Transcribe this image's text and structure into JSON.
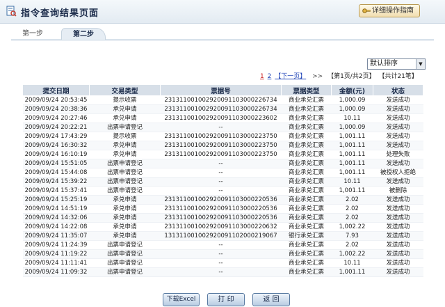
{
  "page": {
    "title": "指令查询结果页面",
    "help_label": "详细操作指南"
  },
  "tabs": [
    {
      "label": "第一步"
    },
    {
      "label": "第二步"
    }
  ],
  "sort": {
    "selected": "默认排序"
  },
  "pager": {
    "page1": "1",
    "page2": "2",
    "next": "【下一页】",
    "arrows": ">>",
    "page_info": "【第1页/共2页】",
    "total": "【共计21笔】"
  },
  "table": {
    "columns": [
      "提交日期",
      "交易类型",
      "票据号",
      "票据类型",
      "金额(元)",
      "状态"
    ],
    "rows": [
      [
        "2009/09/24 20:53:45",
        "提示收票",
        "231311001002920091103000226734",
        "商业承兑汇票",
        "1,000.09",
        "发送成功"
      ],
      [
        "2009/09/24 20:38:36",
        "承兑申请",
        "231311001002920091103000226734",
        "商业承兑汇票",
        "1,000.09",
        "发送成功"
      ],
      [
        "2009/09/24 20:27:46",
        "承兑申请",
        "231311001002920091103000223602",
        "商业承兑汇票",
        "10.11",
        "发送成功"
      ],
      [
        "2009/09/24 20:22:21",
        "出票申请登记",
        "--",
        "商业承兑汇票",
        "1,000.09",
        "发送成功"
      ],
      [
        "2009/09/24 17:43:29",
        "提示收票",
        "231311001002920091103000223750",
        "商业承兑汇票",
        "1,001.11",
        "发送成功"
      ],
      [
        "2009/09/24 16:30:32",
        "承兑申请",
        "231311001002920091103000223750",
        "商业承兑汇票",
        "1,001.11",
        "发送成功"
      ],
      [
        "2009/09/24 16:10:19",
        "承兑申请",
        "231311001002920091103000223750",
        "商业承兑汇票",
        "1,001.11",
        "处理失败"
      ],
      [
        "2009/09/24 15:51:05",
        "出票申请登记",
        "--",
        "商业承兑汇票",
        "1,001.11",
        "发送成功"
      ],
      [
        "2009/09/24 15:44:08",
        "出票申请登记",
        "--",
        "商业承兑汇票",
        "1,001.11",
        "被授权人拒绝"
      ],
      [
        "2009/09/24 15:39:22",
        "出票申请登记",
        "--",
        "商业承兑汇票",
        "10.11",
        "发送成功"
      ],
      [
        "2009/09/24 15:37:41",
        "出票申请登记",
        "--",
        "商业承兑汇票",
        "1,001.11",
        "被删除"
      ],
      [
        "2009/09/24 15:25:19",
        "承兑申请",
        "231311001002920091103000220536",
        "商业承兑汇票",
        "2.02",
        "发送成功"
      ],
      [
        "2009/09/24 14:51:19",
        "承兑申请",
        "231311001002920091103000220536",
        "商业承兑汇票",
        "2.02",
        "发送成功"
      ],
      [
        "2009/09/24 14:32:06",
        "承兑申请",
        "231311001002920091103000220536",
        "商业承兑汇票",
        "2.02",
        "发送成功"
      ],
      [
        "2009/09/24 14:22:08",
        "承兑申请",
        "231311001002920091103000220632",
        "商业承兑汇票",
        "1,002.22",
        "发送成功"
      ],
      [
        "2009/09/24 11:35:07",
        "承兑申请",
        "131311001002920091102000219067",
        "银行承兑汇票",
        "7.93",
        "发送成功"
      ],
      [
        "2009/09/24 11:24:39",
        "出票申请登记",
        "--",
        "商业承兑汇票",
        "2.02",
        "发送成功"
      ],
      [
        "2009/09/24 11:19:22",
        "出票申请登记",
        "--",
        "商业承兑汇票",
        "1,002.22",
        "发送成功"
      ],
      [
        "2009/09/24 11:11:41",
        "出票申请登记",
        "--",
        "商业承兑汇票",
        "10.11",
        "发送成功"
      ],
      [
        "2009/09/24 11:09:32",
        "出票申请登记",
        "--",
        "商业承兑汇票",
        "1,001.11",
        "发送成功"
      ]
    ]
  },
  "buttons": {
    "excel": "下载Excel",
    "print": "打 印",
    "back": "返 回"
  },
  "colors": {
    "header_bg": "#d7dfe8",
    "title_text": "#1b2b4a",
    "link": "#2246b8"
  }
}
